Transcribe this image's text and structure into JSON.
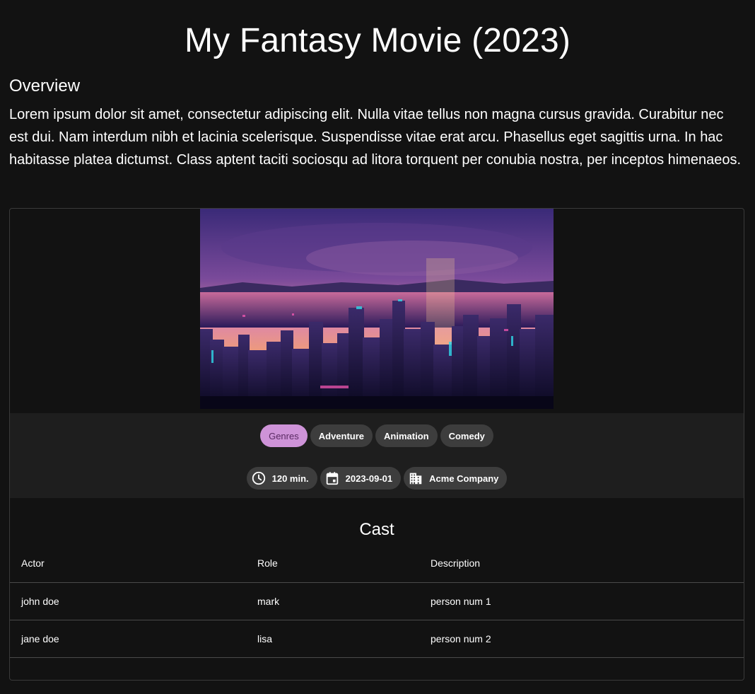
{
  "movie": {
    "title": "My Fantasy Movie (2023)",
    "overview_heading": "Overview",
    "overview": "Lorem ipsum dolor sit amet, consectetur adipiscing elit. Nulla vitae tellus non magna cursus gravida. Curabitur nec est dui. Nam interdum nibh et lacinia scelerisque. Suspendisse vitae erat arcu. Phasellus eget sagittis urna. In hac habitasse platea dictumst. Class aptent taciti sociosqu ad litora torquent per conubia nostra, per inceptos himenaeos."
  },
  "genres": {
    "label": "Genres",
    "items": [
      "Adventure",
      "Animation",
      "Comedy"
    ]
  },
  "meta": {
    "runtime": "120 min.",
    "runtime_icon": "clock-icon",
    "release_date": "2023-09-01",
    "release_icon": "calendar-icon",
    "company": "Acme Company",
    "company_icon": "building-icon"
  },
  "cast": {
    "heading": "Cast",
    "columns": [
      "Actor",
      "Role",
      "Description"
    ],
    "rows": [
      [
        "john doe",
        "mark",
        "person num 1"
      ],
      [
        "jane doe",
        "lisa",
        "person num 2"
      ]
    ]
  },
  "colors": {
    "background": "#121212",
    "panel": "#1e1e1e",
    "chip": "#3d3d3d",
    "accent_chip": "#ce93d8"
  }
}
